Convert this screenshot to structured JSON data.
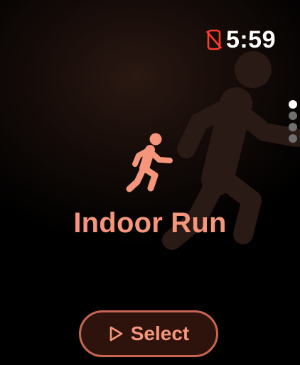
{
  "status": {
    "time": "5:59",
    "indicator_icon": "phone-disconnected-icon",
    "indicator_color": "#ff3b30"
  },
  "pagination": {
    "count": 4,
    "active_index": 0
  },
  "workout": {
    "icon": "running-figure-icon",
    "title": "Indoor Run",
    "accent_color": "#f5957b"
  },
  "actions": {
    "select_label": "Select",
    "select_icon": "play-icon"
  }
}
